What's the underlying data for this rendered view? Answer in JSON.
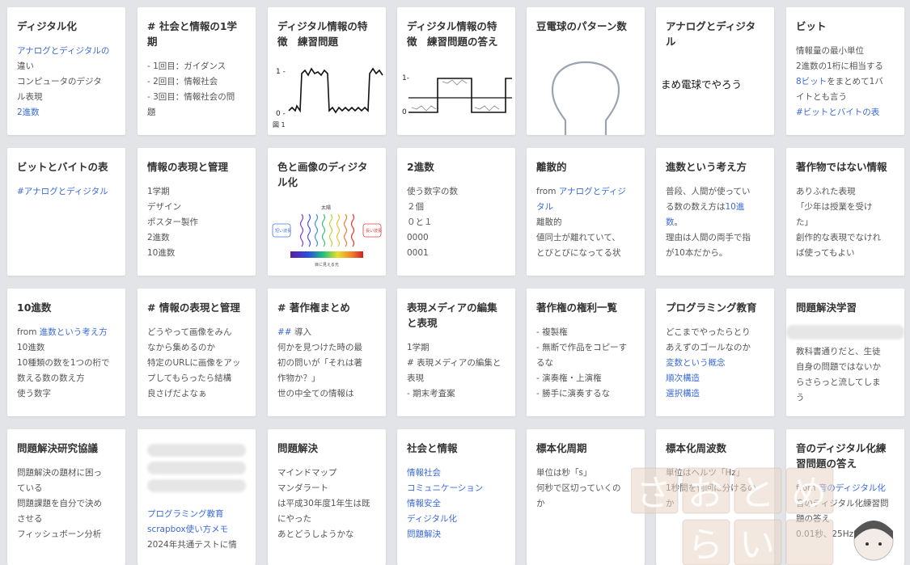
{
  "cards": [
    {
      "title": "ディジタル化",
      "lines": [
        {
          "t": "アナログとディジタルの",
          "k": "lk"
        },
        {
          "t": "違い",
          "k": ""
        },
        {
          "t": "コンピュータのデジタ",
          "k": ""
        },
        {
          "t": "ル表現",
          "k": ""
        },
        {
          "t": "2進数",
          "k": "lk"
        }
      ]
    },
    {
      "title": "# 社会と情報の1学期",
      "lines": [
        {
          "t": "- 1回目：ガイダンス",
          "k": ""
        },
        {
          "t": "- 2回目：情報社会",
          "k": ""
        },
        {
          "t": "- 3回目：情報社会の問",
          "k": ""
        },
        {
          "t": "題",
          "k": ""
        }
      ]
    },
    {
      "title": "ディジタル情報の特徴　練習問題",
      "thumb": {
        "y_hi": "1 -",
        "y_lo": "0 -",
        "caption": "図 1"
      }
    },
    {
      "title": "ディジタル情報の特徴　練習問題の答え",
      "thumb": {
        "y_hi": "1-",
        "y_lo": "0"
      }
    },
    {
      "title": "豆電球のパターン数",
      "thumb": {}
    },
    {
      "title": "アナログとディジタル",
      "thumb": {
        "handwriting": "まめ電球でやろう"
      }
    },
    {
      "title": "ビット",
      "lines": [
        {
          "t": "情報量の最小単位",
          "k": ""
        },
        {
          "t": "2進数の1桁に相当する",
          "k": ""
        },
        {
          "t": "8ビット",
          "k": "lk",
          "rest": "をまとめて1バ"
        },
        {
          "t": "イトとも言う",
          "k": ""
        },
        {
          "t": "#ビットとバイトの表",
          "k": "lk"
        }
      ]
    },
    {
      "title": "ビットとバイトの表",
      "lines": [
        {
          "t": "#アナログとディジタル",
          "k": "lk"
        }
      ]
    },
    {
      "title": "情報の表現と管理",
      "lines": [
        {
          "t": "1学期",
          "k": ""
        },
        {
          "t": "デザイン",
          "k": ""
        },
        {
          "t": "ポスター製作",
          "k": ""
        },
        {
          "t": "2進数",
          "k": ""
        },
        {
          "t": "10進数",
          "k": ""
        }
      ]
    },
    {
      "title": "色と画像のディジタル化",
      "thumb": {
        "sun": "太陽",
        "left": "短い波長",
        "right": "長い波長",
        "bottom": "目に見える光"
      }
    },
    {
      "title": "2進数",
      "lines": [
        {
          "t": "使う数字の数",
          "k": ""
        },
        {
          "t": "２個",
          "k": ""
        },
        {
          "t": "０と１",
          "k": ""
        },
        {
          "t": "0000",
          "k": ""
        },
        {
          "t": "0001",
          "k": ""
        }
      ]
    },
    {
      "title": "離散的",
      "lines": [
        {
          "t": "from ",
          "k": "",
          "link": "アナログとディジ"
        },
        {
          "t": "タル",
          "k": "lk"
        },
        {
          "t": "離散的",
          "k": ""
        },
        {
          "t": "値同士が離れていて、",
          "k": ""
        },
        {
          "t": "とびとびになってる状",
          "k": ""
        }
      ]
    },
    {
      "title": "進数という考え方",
      "lines": [
        {
          "t": "普段、人間が使ってい",
          "k": ""
        },
        {
          "t": "る数の数え方は",
          "k": "",
          "link": "10進"
        },
        {
          "t": "数",
          "k": "lk",
          "rest": "。"
        },
        {
          "t": "理由は人間の両手で指",
          "k": ""
        },
        {
          "t": "が10本だから。",
          "k": ""
        }
      ]
    },
    {
      "title": "著作物ではない情報",
      "lines": [
        {
          "t": "ありふれた表現",
          "k": ""
        },
        {
          "t": "「少年は授業を受け",
          "k": ""
        },
        {
          "t": "た」",
          "k": ""
        },
        {
          "t": "創作的な表現でなけれ",
          "k": ""
        },
        {
          "t": "ば使ってもよい",
          "k": ""
        }
      ]
    },
    {
      "title": "10進数",
      "lines": [
        {
          "t": "from ",
          "k": "",
          "link": "進数という考え方"
        },
        {
          "t": "10進数",
          "k": ""
        },
        {
          "t": "10種類の数を1つの桁で",
          "k": ""
        },
        {
          "t": "数える数の数え方",
          "k": ""
        },
        {
          "t": "使う数字",
          "k": ""
        }
      ]
    },
    {
      "title": "# 情報の表現と管理",
      "lines": [
        {
          "t": "どうやって画像をみん",
          "k": ""
        },
        {
          "t": "なから集めるのか",
          "k": ""
        },
        {
          "t": "特定のURLに画像をアッ",
          "k": ""
        },
        {
          "t": "プしてもらったら結構",
          "k": ""
        },
        {
          "t": "良さげだよなぁ",
          "k": ""
        }
      ]
    },
    {
      "title": "# 著作権まとめ",
      "lines": [
        {
          "t": "##",
          "k": "lk",
          "rest": " 導入"
        },
        {
          "t": "何かを見つけた時の最",
          "k": ""
        },
        {
          "t": "初の問いが「それは著",
          "k": ""
        },
        {
          "t": "作物か？」",
          "k": ""
        },
        {
          "t": "世の中全ての情報は",
          "k": ""
        }
      ]
    },
    {
      "title": "表現メディアの編集と表現",
      "lines": [
        {
          "t": "1学期",
          "k": ""
        },
        {
          "t": "# 表現メディアの編集と",
          "k": ""
        },
        {
          "t": "表現",
          "k": ""
        },
        {
          "t": "- 期末考査案",
          "k": ""
        }
      ]
    },
    {
      "title": "著作権の権利一覧",
      "lines": [
        {
          "t": "- 複製権",
          "k": ""
        },
        {
          "t": "- 無断で作品をコピーす",
          "k": ""
        },
        {
          "t": "るな",
          "k": ""
        },
        {
          "t": "- 演奏権・上演権",
          "k": ""
        },
        {
          "t": "- 勝手に演奏するな",
          "k": ""
        }
      ]
    },
    {
      "title": "プログラミング教育",
      "lines": [
        {
          "t": "どこまでやったらとり",
          "k": ""
        },
        {
          "t": "あえずのゴールなのか",
          "k": ""
        },
        {
          "t": "変数という概念",
          "k": "lk"
        },
        {
          "t": "順次構造",
          "k": "lk"
        },
        {
          "t": "選択構造",
          "k": "lk"
        }
      ]
    },
    {
      "title": "問題解決学習",
      "blur_top": true,
      "lines": [
        {
          "t": "教科書通りだと、生徒",
          "k": ""
        },
        {
          "t": "自身の問題ではないか",
          "k": ""
        },
        {
          "t": "らさらっと流してしま",
          "k": ""
        },
        {
          "t": "う",
          "k": ""
        }
      ]
    },
    {
      "title": "問題解決研究協議",
      "lines": [
        {
          "t": "問題解決の題材に困っ",
          "k": ""
        },
        {
          "t": "ている",
          "k": ""
        },
        {
          "t": "問題課題を自分で決め",
          "k": ""
        },
        {
          "t": "させる",
          "k": ""
        },
        {
          "t": "フィッシュボーン分析",
          "k": ""
        }
      ]
    },
    {
      "title": "",
      "blurred": true,
      "lines": [
        {
          "t": "プログラミング教育",
          "k": "lk"
        },
        {
          "t": "scrapbox使い方メモ",
          "k": "lk"
        },
        {
          "t": "2024年共通テストに情",
          "k": ""
        }
      ]
    },
    {
      "title": "問題解決",
      "lines": [
        {
          "t": "マインドマップ",
          "k": ""
        },
        {
          "t": "マンダラート",
          "k": ""
        },
        {
          "t": "は平成30年度1年生は既",
          "k": ""
        },
        {
          "t": "にやった",
          "k": ""
        },
        {
          "t": "あとどうしようかな",
          "k": ""
        }
      ]
    },
    {
      "title": "社会と情報",
      "lines": [
        {
          "t": "情報社会",
          "k": "lk"
        },
        {
          "t": "コミュニケーション",
          "k": "lk"
        },
        {
          "t": "情報安全",
          "k": "lk"
        },
        {
          "t": "ディジタル化",
          "k": "lk"
        },
        {
          "t": "問題解決",
          "k": "lk"
        }
      ]
    },
    {
      "title": "標本化周期",
      "lines": [
        {
          "t": "単位は秒「s」",
          "k": ""
        },
        {
          "t": "何秒で区切っていくの",
          "k": ""
        },
        {
          "t": "か",
          "k": ""
        }
      ]
    },
    {
      "title": "標本化周波数",
      "lines": [
        {
          "t": "単位はヘルツ「Hz」",
          "k": ""
        },
        {
          "t": "1秒間を何回に分けるの",
          "k": ""
        },
        {
          "t": "か",
          "k": ""
        }
      ]
    },
    {
      "title": "音のディジタル化練習問題の答え",
      "lines": [
        {
          "t": "from ",
          "k": "",
          "link": "音のディジタル化"
        },
        {
          "t": "音のディジタル化練習問",
          "k": ""
        },
        {
          "t": "題の答え",
          "k": ""
        },
        {
          "t": "0.01秒、25Hz、",
          "k": ""
        }
      ]
    }
  ],
  "watermark": {
    "line1": "さおとめ",
    "line2": "らい"
  }
}
